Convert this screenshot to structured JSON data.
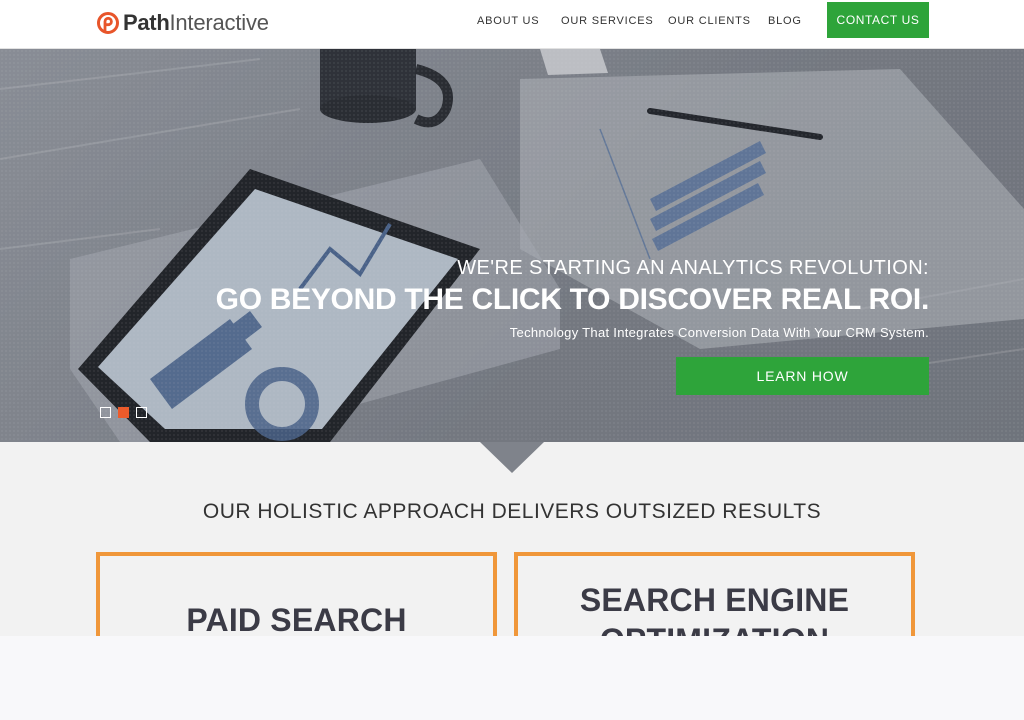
{
  "brand": {
    "name_bold": "Path",
    "name_light": "Interactive",
    "accent": "#e8552a"
  },
  "nav": {
    "items": [
      {
        "label": "ABOUT US"
      },
      {
        "label": "OUR SERVICES"
      },
      {
        "label": "OUR CLIENTS"
      },
      {
        "label": "BLOG"
      }
    ],
    "cta_label": "CONTACT US",
    "cta_color": "#2ea43a"
  },
  "hero": {
    "kicker": "WE'RE STARTING AN ANALYTICS REVOLUTION:",
    "title": "GO BEYOND THE CLICK TO DISCOVER REAL ROI.",
    "subtitle": "Technology That Integrates Conversion Data With Your CRM System.",
    "button_label": "LEARN HOW",
    "slides": {
      "count": 3,
      "active_index": 1
    },
    "dot_active_color": "#ec5b2b"
  },
  "section": {
    "title": "OUR HOLISTIC APPROACH DELIVERS OUTSIZED RESULTS",
    "cards": [
      {
        "title": "PAID SEARCH"
      },
      {
        "title": "SEARCH ENGINE OPTIMIZATION"
      }
    ],
    "card_border_color": "#f0973a"
  }
}
